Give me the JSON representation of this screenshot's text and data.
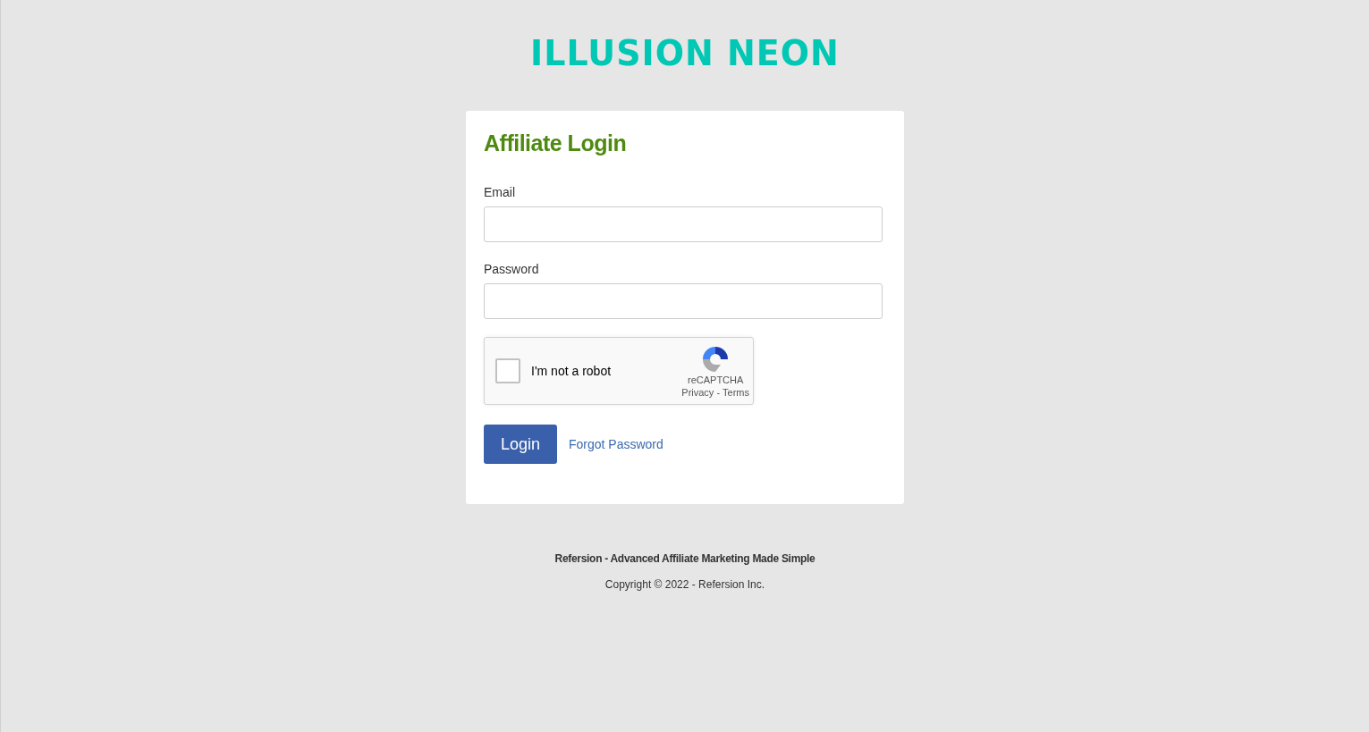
{
  "logo": "ILLUSION NEON",
  "card": {
    "title": "Affiliate Login",
    "fields": [
      {
        "label": "Email"
      },
      {
        "label": "Password"
      }
    ],
    "captcha": {
      "label": "I'm not a robot",
      "checked": false,
      "brand": "reCAPTCHA",
      "privacy": "Privacy",
      "separator": "-",
      "terms": "Terms"
    },
    "login_button": "Login",
    "forgot_link": "Forgot Password"
  },
  "footer": {
    "tagline": "Refersion - Advanced Affiliate Marketing Made Simple",
    "copyright": "Copyright © 2022 - Refersion Inc."
  }
}
